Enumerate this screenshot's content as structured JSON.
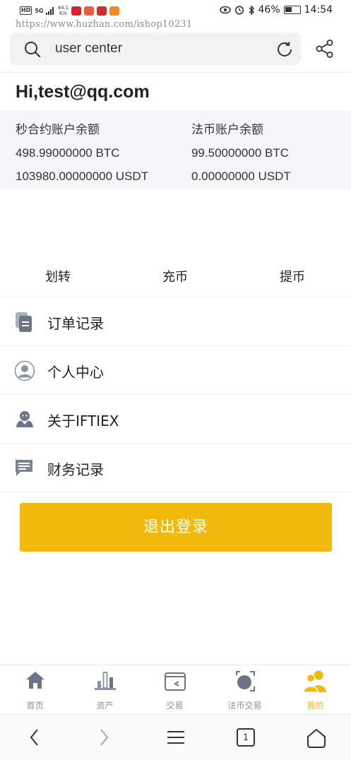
{
  "status_bar": {
    "network_label": "HD",
    "signal_label": "5G",
    "speed_value": "44.1",
    "speed_unit": "K/s",
    "battery_percent": "46%",
    "time": "14:54"
  },
  "watermark": {
    "url": "https://www.huzhan.com/ishop10231"
  },
  "search": {
    "text": "user center"
  },
  "user": {
    "greeting": "Hi,test@qq.com"
  },
  "balances": {
    "contract": {
      "title": "秒合约账户余额",
      "btc": "498.99000000 BTC",
      "usdt": "103980.00000000 USDT"
    },
    "fiat": {
      "title": "法币账户余额",
      "btc": "99.50000000 BTC",
      "usdt": "0.00000000 USDT"
    }
  },
  "actions": [
    {
      "label": "划转"
    },
    {
      "label": "充币"
    },
    {
      "label": "提币"
    }
  ],
  "menu": [
    {
      "label": "订单记录",
      "icon": "orders-icon"
    },
    {
      "label": "个人中心",
      "icon": "person-icon"
    },
    {
      "label": "关于IFTIEX",
      "icon": "about-icon"
    },
    {
      "label": "财务记录",
      "icon": "message-icon"
    }
  ],
  "logout": {
    "label": "退出登录"
  },
  "tabs": [
    {
      "label": "首页",
      "icon": "home-icon"
    },
    {
      "label": "资产",
      "icon": "assets-icon"
    },
    {
      "label": "交易",
      "icon": "trade-icon"
    },
    {
      "label": "法币交易",
      "icon": "fiat-trade-icon"
    },
    {
      "label": "我的",
      "icon": "profile-icon",
      "active": true
    }
  ],
  "system_nav": {
    "tab_count": "1"
  },
  "colors": {
    "accent": "#f0b90b",
    "panel": "#f4f6f9",
    "tab_inactive": "#8a8f99",
    "icon_gray": "#6b7585"
  }
}
